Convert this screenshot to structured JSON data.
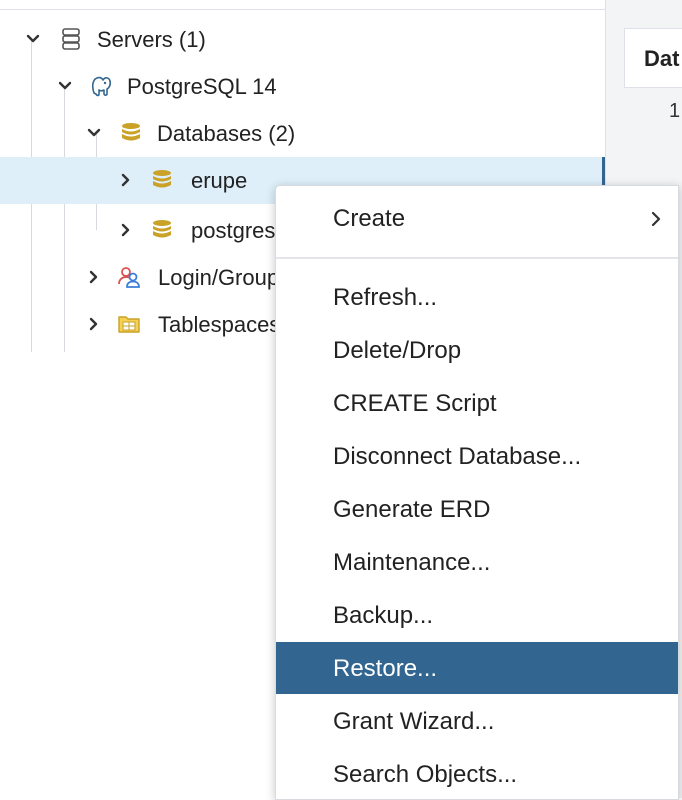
{
  "tree": {
    "servers": {
      "label": "Servers (1)",
      "icon": "server-group-icon"
    },
    "server": {
      "label": "PostgreSQL 14",
      "icon": "postgresql-elephant-icon"
    },
    "databases": {
      "label": "Databases (2)",
      "icon": "databases-icon"
    },
    "erupe": {
      "label": "erupe",
      "icon": "database-icon",
      "selected": true
    },
    "postgres": {
      "label": "postgres",
      "icon": "database-icon"
    },
    "login_roles": {
      "label": "Login/Group Roles",
      "icon": "login-roles-icon"
    },
    "tablespaces": {
      "label": "Tablespaces",
      "icon": "tablespaces-icon"
    }
  },
  "right_panel": {
    "tab_label": "Dat",
    "cell_value": "1"
  },
  "context_menu": {
    "create": {
      "label": "Create"
    },
    "items": [
      {
        "label": "Refresh..."
      },
      {
        "label": "Delete/Drop"
      },
      {
        "label": "CREATE Script"
      },
      {
        "label": "Disconnect Database..."
      },
      {
        "label": "Generate ERD"
      },
      {
        "label": "Maintenance..."
      },
      {
        "label": "Backup..."
      },
      {
        "label": "Restore...",
        "highlighted": true
      },
      {
        "label": "Grant Wizard..."
      },
      {
        "label": "Search Objects..."
      }
    ]
  },
  "colors": {
    "selection_bg": "#deeffa",
    "highlight_bg": "#326690",
    "database_gold": "#c9a227",
    "tree_guide": "#d6d9de"
  }
}
